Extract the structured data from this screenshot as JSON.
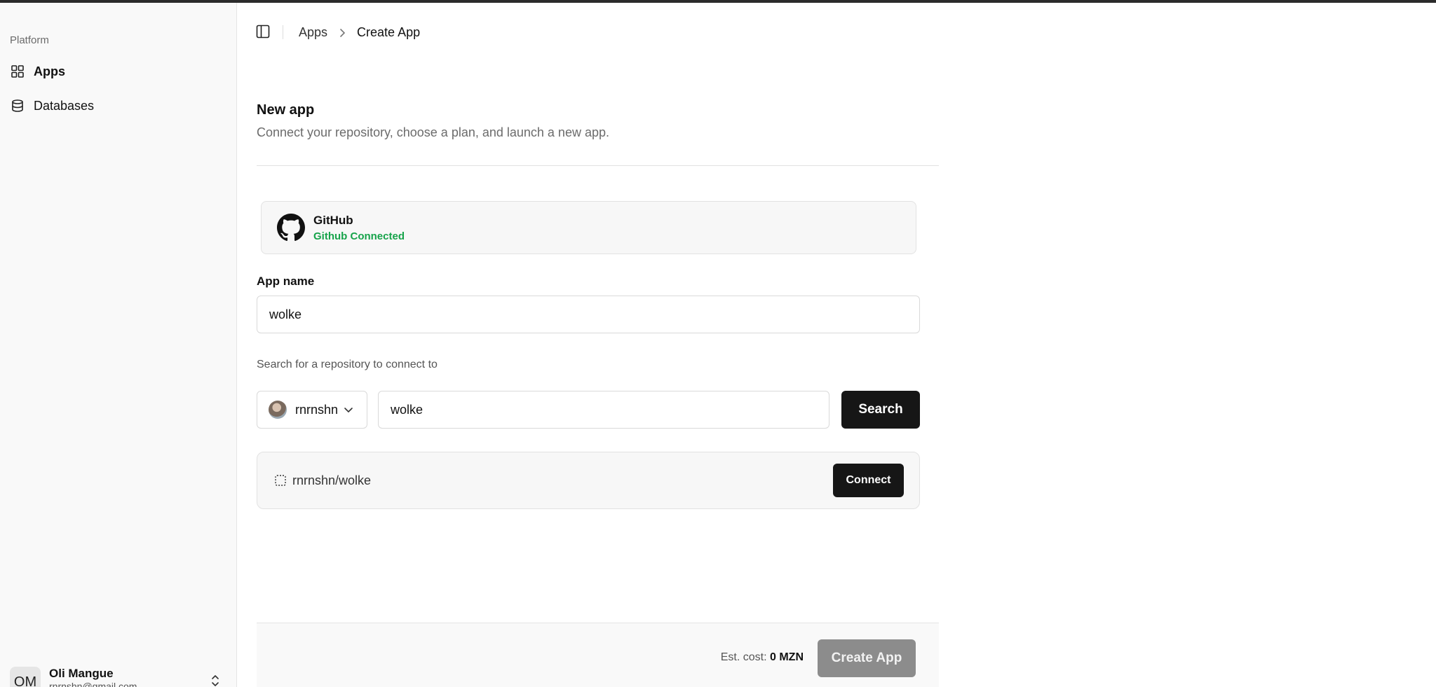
{
  "sidebar": {
    "section_label": "Platform",
    "items": [
      {
        "label": "Apps",
        "icon": "grid-icon",
        "active": true
      },
      {
        "label": "Databases",
        "icon": "database-icon",
        "active": false
      }
    ],
    "user": {
      "initials": "OM",
      "name": "Oli Mangue",
      "email": "rnrnshn@gmail.com"
    }
  },
  "header": {
    "breadcrumb": [
      "Apps",
      "Create App"
    ]
  },
  "main": {
    "title": "New app",
    "subtitle": "Connect your repository, choose a plan, and launch a new app.",
    "github": {
      "name": "GitHub",
      "status": "Github Connected",
      "status_color": "#16a34a"
    },
    "app_name": {
      "label": "App name",
      "value": "wolke"
    },
    "repo_search": {
      "hint": "Search for a repository to connect to",
      "owner": "rnrnshn",
      "query": "wolke",
      "button": "Search"
    },
    "results": [
      {
        "repo": "rnrnshn/wolke",
        "action": "Connect"
      }
    ]
  },
  "footer": {
    "cost_label": "Est. cost:",
    "cost_value": "0 MZN",
    "create_button": "Create App"
  }
}
